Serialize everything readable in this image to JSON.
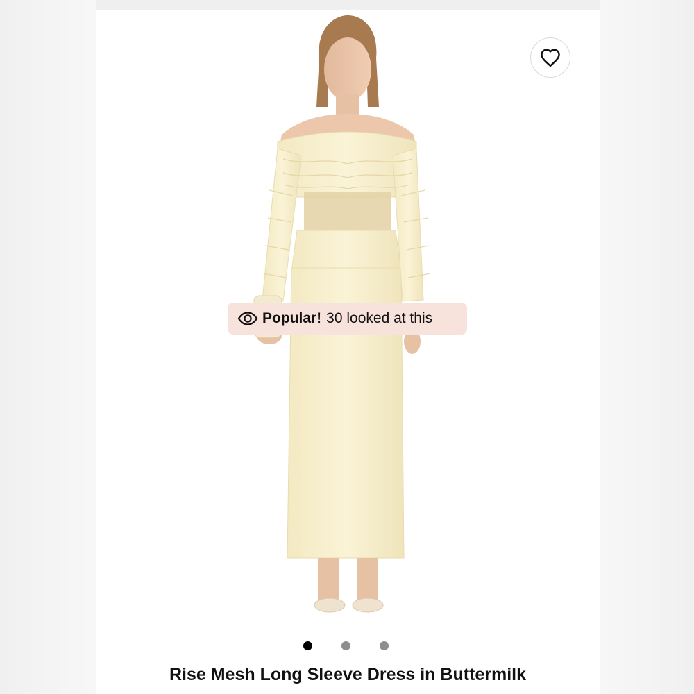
{
  "product": {
    "title": "Rise Mesh Long Sleeve Dress in Buttermilk",
    "image_alt": "Model wearing off-shoulder cream mesh long sleeve maxi dress",
    "dress_color": "#f8f0cf"
  },
  "badge": {
    "icon": "eye-icon",
    "strong_label": "Popular!",
    "text": "30 looked at this"
  },
  "wishlist": {
    "icon": "heart-icon"
  },
  "carousel": {
    "total": 3,
    "active_index": 0
  }
}
